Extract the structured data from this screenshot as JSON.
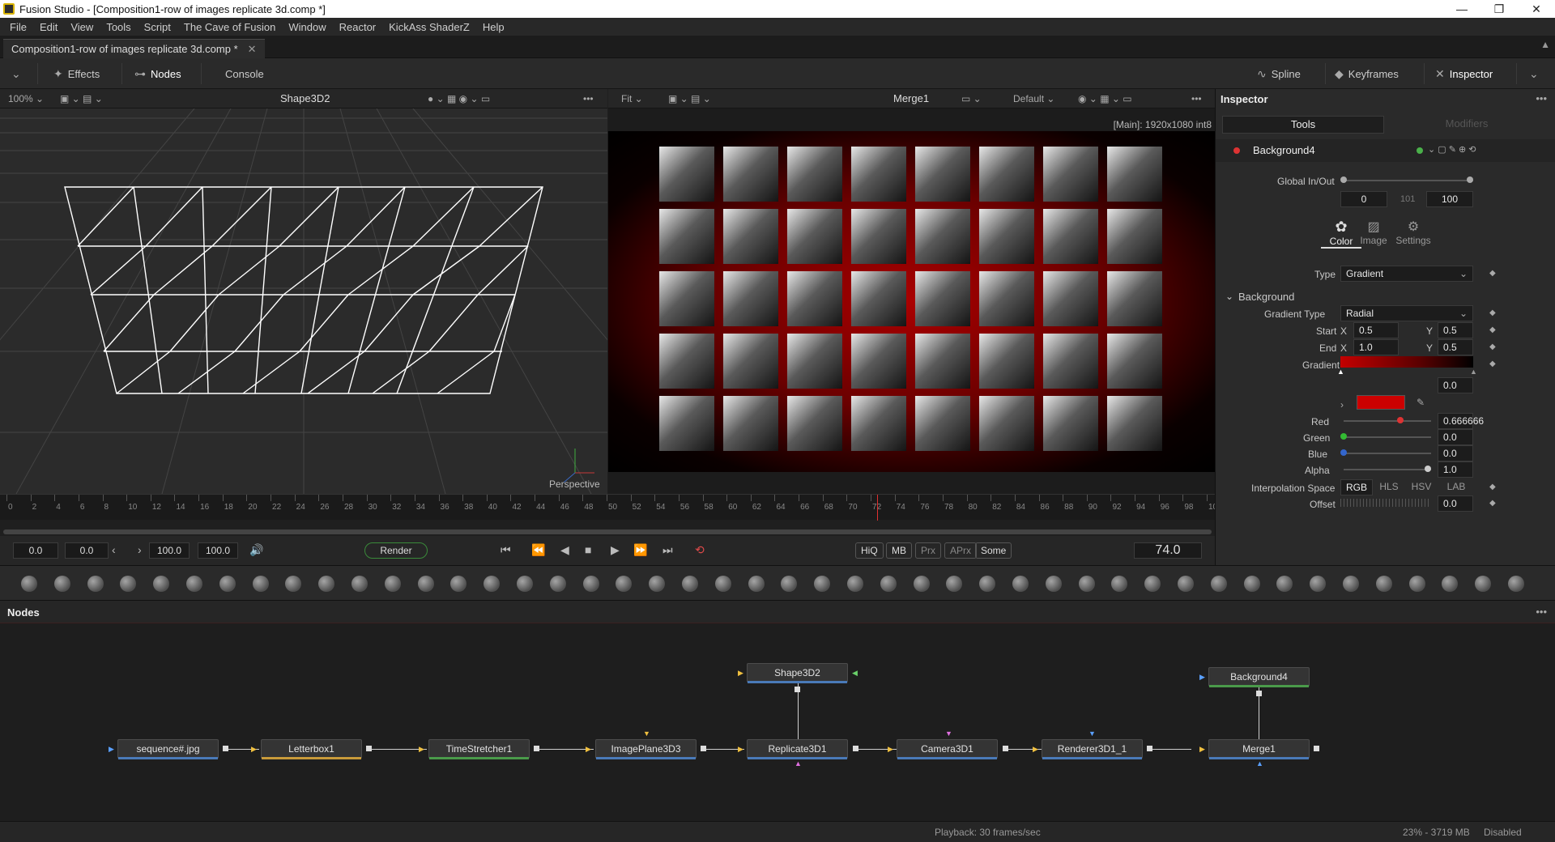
{
  "window": {
    "title": "Fusion Studio - [Composition1-row of images replicate 3d.comp *]",
    "min": "—",
    "max": "❐",
    "close": "✕"
  },
  "menu": [
    "File",
    "Edit",
    "View",
    "Tools",
    "Script",
    "The Cave of Fusion",
    "Window",
    "Reactor",
    "KickAss ShaderZ",
    "Help"
  ],
  "doc_tab": {
    "label": "Composition1-row of images replicate 3d.comp *",
    "close": "✕"
  },
  "toolbar": {
    "effects": "Effects",
    "nodes": "Nodes",
    "console": "Console",
    "spline": "Spline",
    "keyframes": "Keyframes",
    "inspector": "Inspector"
  },
  "viewer_left": {
    "zoom": "100%",
    "title": "Shape3D2",
    "label": "Perspective"
  },
  "viewer_right": {
    "zoom": "Fit",
    "title": "Merge1",
    "lut": "Default",
    "info": "[Main]: 1920x1080 int8"
  },
  "timeline": {
    "ticks": [
      "0",
      "2",
      "4",
      "6",
      "8",
      "10",
      "12",
      "14",
      "16",
      "18",
      "20",
      "22",
      "24",
      "26",
      "28",
      "30",
      "32",
      "34",
      "36",
      "38",
      "40",
      "42",
      "44",
      "46",
      "48",
      "50",
      "52",
      "54",
      "56",
      "58",
      "60",
      "62",
      "64",
      "66",
      "68",
      "70",
      "72",
      "74",
      "76",
      "78",
      "80",
      "82",
      "84",
      "86",
      "88",
      "90",
      "92",
      "94",
      "96",
      "98",
      "10"
    ],
    "playhead_frame": 74
  },
  "transport": {
    "start": "0.0",
    "render_start": "0.0",
    "render_end": "100.0",
    "end": "100.0",
    "render": "Render",
    "hiq": "HiQ",
    "mb": "MB",
    "prx": "Prx",
    "aprx": "APrx",
    "some": "Some",
    "current_frame": "74.0"
  },
  "nodes_panel": {
    "title": "Nodes",
    "menu": "•••"
  },
  "nodes": [
    {
      "label": "sequence#.jpg",
      "color": "#4a7ab8"
    },
    {
      "label": "Letterbox1",
      "color": "#c89a3a"
    },
    {
      "label": "TimeStretcher1",
      "color": "#4a9a4a"
    },
    {
      "label": "ImagePlane3D3",
      "color": "#4a7ab8"
    },
    {
      "label": "Replicate3D1",
      "color": "#4a7ab8"
    },
    {
      "label": "Camera3D1",
      "color": "#4a7ab8"
    },
    {
      "label": "Renderer3D1_1",
      "color": "#4a7ab8"
    },
    {
      "label": "Merge1",
      "color": "#4a7ab8"
    },
    {
      "label": "Shape3D2",
      "color": "#4a7ab8"
    },
    {
      "label": "Background4",
      "color": "#4a9a4a"
    }
  ],
  "status": {
    "playback": "Playback: 30 frames/sec",
    "memory": "23% - 3719 MB",
    "state": "Disabled"
  },
  "inspector": {
    "title": "Inspector",
    "tabs": {
      "tools": "Tools",
      "modifiers": "Modifiers"
    },
    "tool_name": "Background4",
    "global_label": "Global In/Out",
    "global_in": "0",
    "global_mid": "101",
    "global_out": "100",
    "subtabs": [
      "Color",
      "Image",
      "Settings"
    ],
    "type_label": "Type",
    "type_value": "Gradient",
    "section": "Background",
    "gradient_type_label": "Gradient Type",
    "gradient_type_value": "Radial",
    "start_label": "Start",
    "end_label": "End",
    "x": "X",
    "y": "Y",
    "start_x": "0.5",
    "start_y": "0.5",
    "end_x": "1.0",
    "end_y": "0.5",
    "gradient_label": "Gradient",
    "gradient_pos": "0.0",
    "swatch_color": "#cc0000",
    "red_label": "Red",
    "red": "0.666666",
    "green_label": "Green",
    "green": "0.0",
    "blue_label": "Blue",
    "blue": "0.0",
    "alpha_label": "Alpha",
    "alpha": "1.0",
    "interp_label": "Interpolation Space",
    "interp_options": [
      "RGB",
      "HLS",
      "HSV",
      "LAB"
    ],
    "offset_label": "Offset",
    "offset": "0.0"
  }
}
